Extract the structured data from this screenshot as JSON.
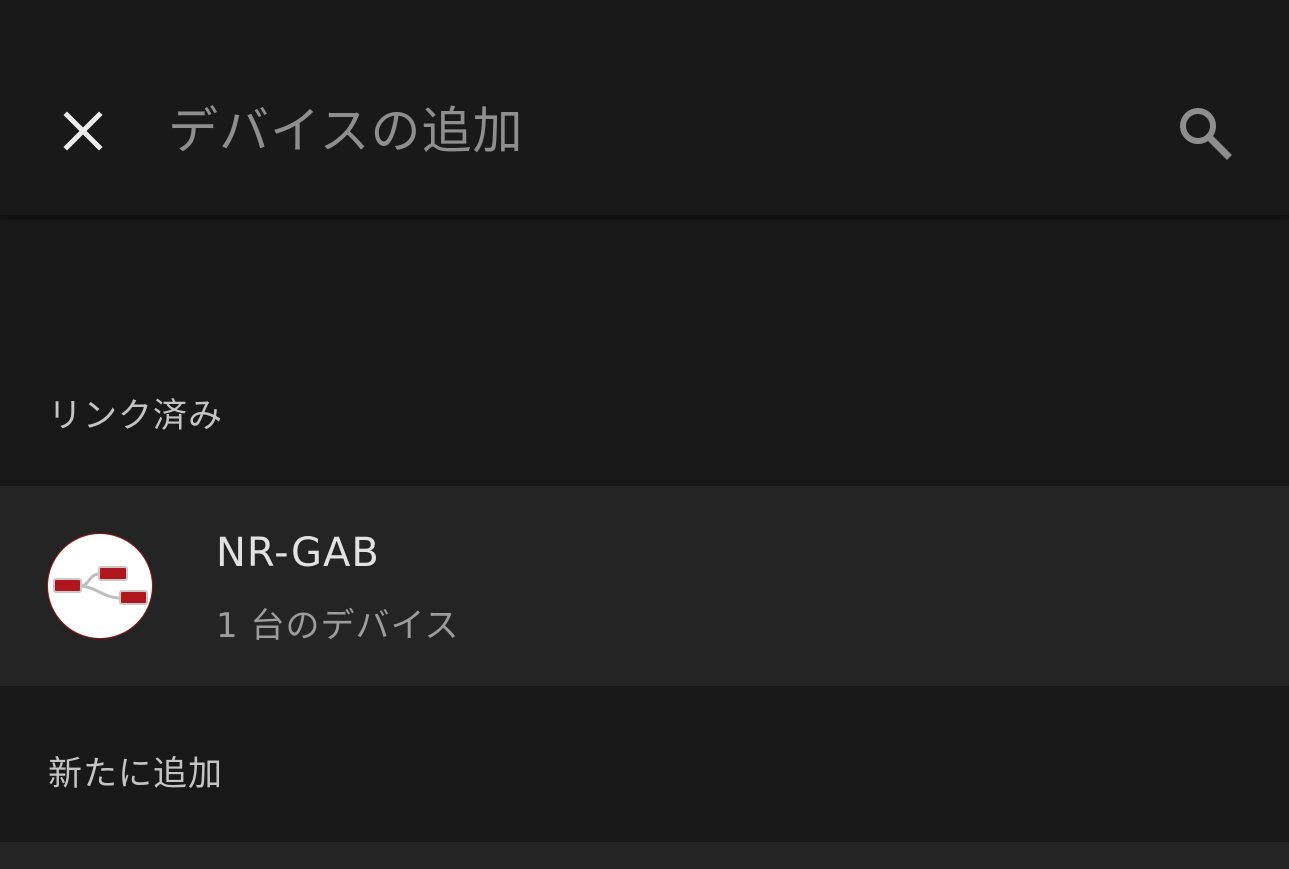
{
  "header": {
    "title": "デバイスの追加",
    "close_icon": "close-icon",
    "search_icon": "search-icon"
  },
  "sections": {
    "linked": "リンク済み",
    "new": "新たに追加"
  },
  "devices": [
    {
      "name": "NR-GAB",
      "subtitle": "1 台のデバイス",
      "icon": "flow-nodes-icon"
    }
  ],
  "colors": {
    "background": "#181818",
    "header": "#191919",
    "row": "#242424",
    "node_red": "#b0161d",
    "node_border": "#c9c9c9"
  }
}
